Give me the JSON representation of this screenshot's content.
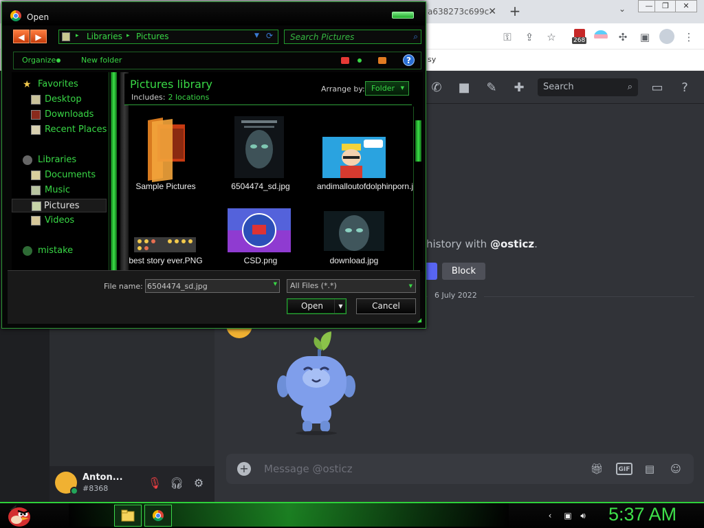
{
  "browser": {
    "tab_title": "a638273c699c",
    "close_tab_glyph": "✕",
    "new_tab_glyph": "+",
    "tab_search_glyph": "⌄",
    "window_controls": [
      "—",
      "❐",
      "✕"
    ],
    "extension_count": "268",
    "bookmark_partial_text": "sy"
  },
  "discord": {
    "search_placeholder": "Search",
    "intro_text": "history with ",
    "intro_user": "@osticz",
    "intro_period": ".",
    "block_button": "Block",
    "date_divider": "6 July 2022",
    "message_placeholder": "Message @osticz",
    "gif_label": "GIF",
    "user": {
      "name": "Anton...",
      "tag": "#8368"
    },
    "accent_color": "#5865f2"
  },
  "dialog": {
    "title": "Open",
    "breadcrumb": [
      "Libraries",
      "Pictures"
    ],
    "search_placeholder": "Search Pictures",
    "toolbar": {
      "organize_label": "Organize",
      "new_folder_label": "New folder",
      "help_glyph": "?"
    },
    "navigation": [
      {
        "label": "Favorites",
        "icon": "star-icon",
        "group": true
      },
      {
        "label": "Desktop",
        "icon": "desktop-icon"
      },
      {
        "label": "Downloads",
        "icon": "downloads-icon"
      },
      {
        "label": "Recent Places",
        "icon": "recent-places-icon"
      },
      {
        "label": "Libraries",
        "icon": "libraries-icon",
        "group": true
      },
      {
        "label": "Documents",
        "icon": "documents-icon"
      },
      {
        "label": "Music",
        "icon": "music-icon"
      },
      {
        "label": "Pictures",
        "icon": "pictures-icon",
        "selected": true
      },
      {
        "label": "Videos",
        "icon": "videos-icon"
      },
      {
        "label": "mistake",
        "icon": "homegroup-icon",
        "group": true
      }
    ],
    "library": {
      "title": "Pictures library",
      "includes_label": "Includes:",
      "locations_link": "2 locations",
      "arrange_label": "Arrange by:",
      "arrange_value": "Folder"
    },
    "files": [
      {
        "label": "Sample Pictures",
        "kind": "folder"
      },
      {
        "label": "6504474_sd.jpg",
        "kind": "poster"
      },
      {
        "label": "andimalloutofdolphinporn.jpg",
        "kind": "comic"
      },
      {
        "label": "best story ever.PNG",
        "kind": "emoji-strip"
      },
      {
        "label": "CSD.png",
        "kind": "logo"
      },
      {
        "label": "download.jpg",
        "kind": "portrait"
      }
    ],
    "file_name_label": "File name:",
    "file_name_value": "6504474_sd.jpg",
    "file_type_filter": "All Files (*.*)",
    "open_button": "Open",
    "cancel_button": "Cancel",
    "theme_color": "#39d846"
  },
  "taskbar": {
    "clock": "5:37 AM"
  }
}
